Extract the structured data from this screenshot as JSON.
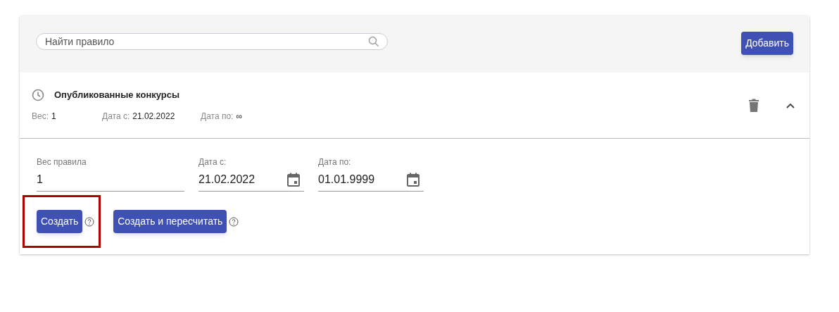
{
  "search": {
    "placeholder": "Найти правило"
  },
  "add_button": "Добавить",
  "rule": {
    "title": "Опубликованные конкурсы",
    "expanded": true,
    "summary": [
      {
        "label": "Вес:",
        "value": "1"
      },
      {
        "label": "Дата с:",
        "value": "21.02.2022"
      },
      {
        "label": "Дата по:",
        "value": "∞"
      }
    ],
    "fields": [
      {
        "kind": "text",
        "label": "Вес правила",
        "value": "1"
      },
      {
        "kind": "date",
        "label": "Дата с:",
        "value": "21.02.2022"
      },
      {
        "kind": "date",
        "label": "Дата по:",
        "value": "01.01.9999"
      }
    ],
    "buttons": [
      {
        "label": "Создать",
        "highlighted": true
      },
      {
        "label": "Создать и пересчитать",
        "highlighted": false
      }
    ]
  }
}
